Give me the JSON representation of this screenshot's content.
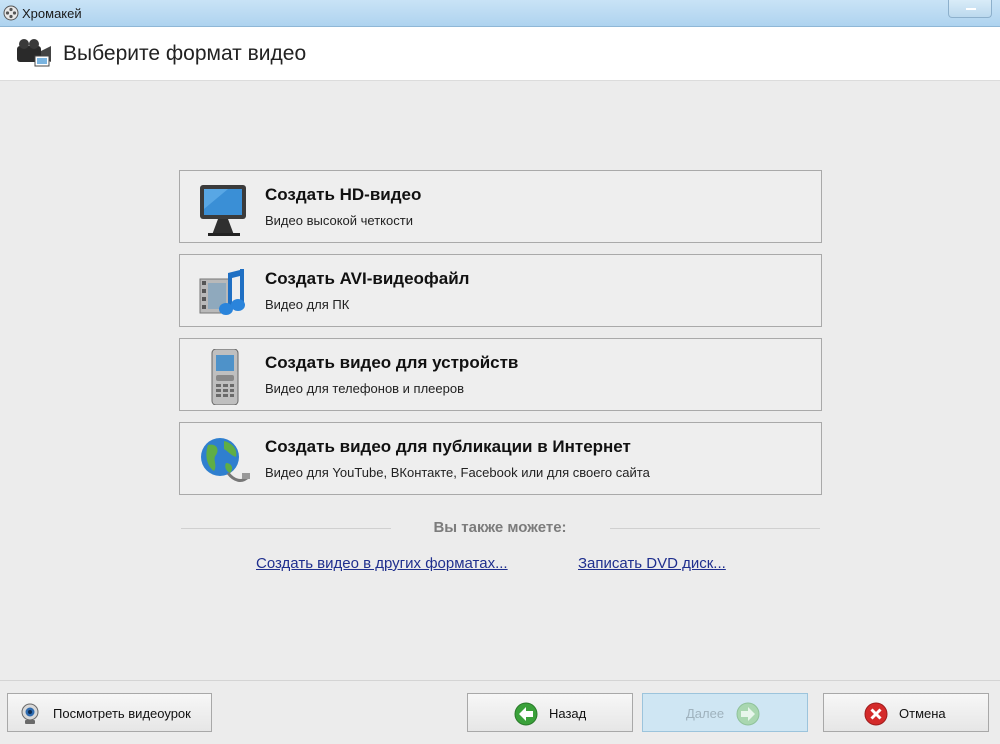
{
  "window": {
    "title": "Хромакей"
  },
  "header": {
    "title": "Выберите формат видео"
  },
  "options": [
    {
      "title": "Создать HD-видео",
      "subtitle": "Видео высокой четкости",
      "icon": "monitor-icon"
    },
    {
      "title": "Создать AVI-видеофайл",
      "subtitle": "Видео для ПК",
      "icon": "film-music-icon"
    },
    {
      "title": "Создать видео для устройств",
      "subtitle": "Видео для телефонов и плееров",
      "icon": "phone-icon"
    },
    {
      "title": "Создать видео для публикации в Интернет",
      "subtitle": "Видео для YouTube, ВКонтакте, Facebook или для своего сайта",
      "icon": "globe-icon"
    }
  ],
  "also": {
    "label": "Вы также можете:",
    "links": [
      "Создать видео в других форматах...",
      "Записать DVD диск..."
    ]
  },
  "footer": {
    "tutorial_label": "Посмотреть видеоурок",
    "back_label": "Назад",
    "next_label": "Далее",
    "cancel_label": "Отмена"
  },
  "colors": {
    "link": "#1f2f8e",
    "accent_green": "#3aa13a",
    "cancel_red": "#d42a2a"
  }
}
